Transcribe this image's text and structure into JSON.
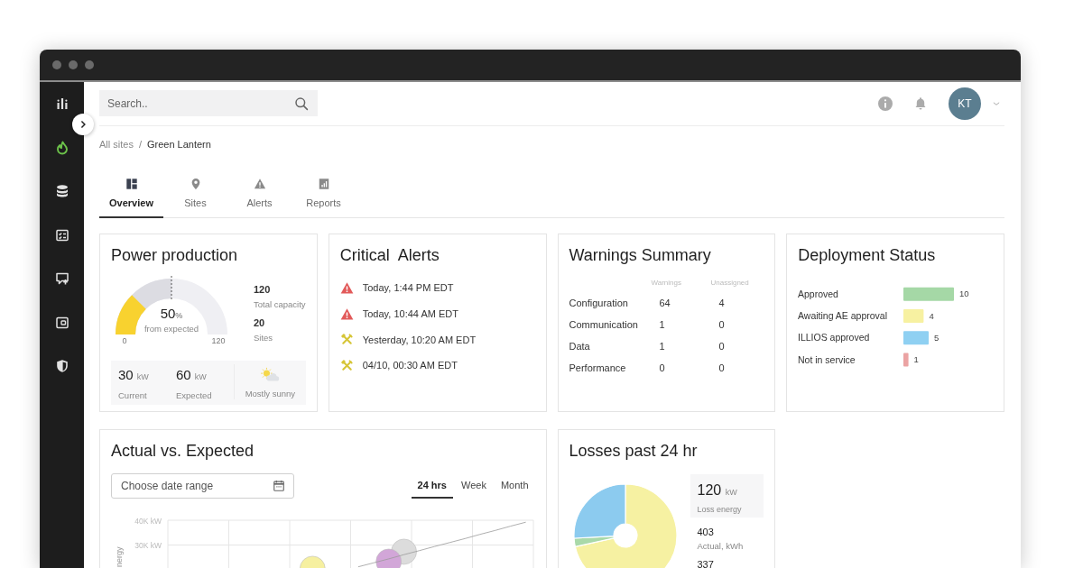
{
  "search": {
    "placeholder": "Search.."
  },
  "sidebar": {
    "items": [
      {
        "selected": false
      },
      {
        "selected": true
      },
      {
        "selected": false
      },
      {
        "selected": false
      },
      {
        "selected": false
      },
      {
        "selected": false
      },
      {
        "selected": false
      }
    ]
  },
  "header": {
    "avatar": {
      "initials": "KT"
    }
  },
  "breadcrumb": {
    "items": [
      "All sites",
      "Green Lantern"
    ],
    "separator": "/"
  },
  "tabs": [
    {
      "label": "Overview",
      "selected": true
    },
    {
      "label": "Sites",
      "selected": false
    },
    {
      "label": "Alerts",
      "selected": false
    },
    {
      "label": "Reports",
      "selected": false
    }
  ],
  "power_production": {
    "title": "Power production",
    "gauge": {
      "actual": {
        "level": 0.25
      },
      "expected": {
        "level": 0.5
      },
      "value": "50",
      "unit": "%",
      "caption": "from expected",
      "min_label": "0",
      "max_label": "120"
    },
    "stats": [
      {
        "value": "120",
        "label": "Total capacity"
      },
      {
        "value": "20",
        "label": "Sites"
      }
    ],
    "readings": [
      {
        "value": "30",
        "unit": "kW",
        "label": "Current"
      },
      {
        "value": "60",
        "unit": "kW",
        "label": "Expected"
      }
    ],
    "weather": {
      "label": "Mostly sunny"
    }
  },
  "critical_alerts": {
    "title": "Critical  Alerts",
    "items": [
      {
        "kind": "critical",
        "text": "Today, 1:44 PM EDT"
      },
      {
        "kind": "critical",
        "text": "Today, 10:44 AM EDT"
      },
      {
        "kind": "maintenance",
        "text": "Yesterday, 10:20 AM EDT"
      },
      {
        "kind": "maintenance",
        "text": "04/10, 00:30 AM EDT"
      }
    ]
  },
  "warnings_summary": {
    "title": "Warnings Summary",
    "columns": [
      "Warnings",
      "Unassigned"
    ],
    "rows": [
      {
        "label": "Configuration",
        "warnings": "64",
        "unassigned": "4"
      },
      {
        "label": "Communication",
        "warnings": "1",
        "unassigned": "0"
      },
      {
        "label": "Data",
        "warnings": "1",
        "unassigned": "0"
      },
      {
        "label": "Performance",
        "warnings": "0",
        "unassigned": "0"
      }
    ]
  },
  "deployment_status": {
    "title": "Deployment Status",
    "chart_data": {
      "type": "bar",
      "orientation": "horizontal",
      "data_labels": true,
      "categories": [
        "Approved",
        "Awaiting AE approval",
        "ILLIOS approved",
        "Not in service"
      ],
      "series": [
        {
          "color": "#a5d8a6",
          "values": [
            10,
            null,
            null,
            null
          ]
        },
        {
          "color": "#f7f1a1",
          "values": [
            null,
            4,
            null,
            null
          ]
        },
        {
          "color": "#8fd0f2",
          "values": [
            null,
            null,
            5,
            null
          ]
        },
        {
          "color": "#eba3a3",
          "values": [
            null,
            null,
            null,
            1
          ]
        }
      ]
    }
  },
  "actual_vs_expected": {
    "title": "Actual vs. Expected",
    "date_range": {
      "placeholder": "Choose date range"
    },
    "ranges": [
      {
        "label": "24 hrs",
        "selected": true
      },
      {
        "label": "Week",
        "selected": false
      },
      {
        "label": "Month",
        "selected": false
      }
    ],
    "chart_data": {
      "type": "line",
      "ylabel": "nergy",
      "categories": [
        null,
        null,
        null,
        null,
        null,
        null,
        null,
        null,
        null,
        null,
        null,
        null,
        null,
        null,
        null,
        null,
        null,
        null,
        null,
        null,
        null,
        null,
        null,
        null
      ],
      "ylim": [
        20000,
        40000
      ],
      "yticks": [
        {
          "value": 30000,
          "label": "30K kW"
        },
        {
          "value": 40000,
          "label": "40K kW"
        }
      ],
      "series": [
        {
          "color": "#f6f0a0",
          "marker": "circle",
          "values": [
            null,
            null,
            null,
            null,
            null,
            null,
            null,
            null,
            null,
            20400,
            null,
            null,
            null,
            null,
            null,
            null,
            null,
            null,
            null,
            null,
            null,
            null,
            null,
            null
          ]
        },
        {
          "color": "#dcdcdc",
          "marker": "circle",
          "values": [
            null,
            null,
            null,
            null,
            null,
            null,
            null,
            null,
            null,
            null,
            null,
            null,
            null,
            null,
            null,
            27300,
            null,
            null,
            null,
            null,
            null,
            null,
            null,
            null
          ]
        },
        {
          "color": "#d2a6d8",
          "marker": "circle",
          "values": [
            null,
            null,
            null,
            null,
            null,
            null,
            null,
            null,
            null,
            null,
            null,
            null,
            null,
            null,
            23300,
            null,
            null,
            null,
            null,
            null,
            null,
            null,
            null,
            null
          ]
        },
        {
          "color": "#9a9a9a",
          "values": [
            null,
            null,
            null,
            null,
            null,
            null,
            null,
            null,
            null,
            null,
            null,
            null,
            21200,
            22800,
            24400,
            26100,
            27700,
            29400,
            31000,
            32600,
            34300,
            35900,
            37600,
            39200
          ]
        }
      ]
    }
  },
  "losses": {
    "title": "Losses past 24 hr",
    "loss_energy": {
      "value": "120",
      "unit": "kW",
      "label": "Loss energy"
    },
    "stats": [
      {
        "value": "403",
        "label": "Actual, kWh"
      },
      {
        "value": "337"
      }
    ]
  }
}
